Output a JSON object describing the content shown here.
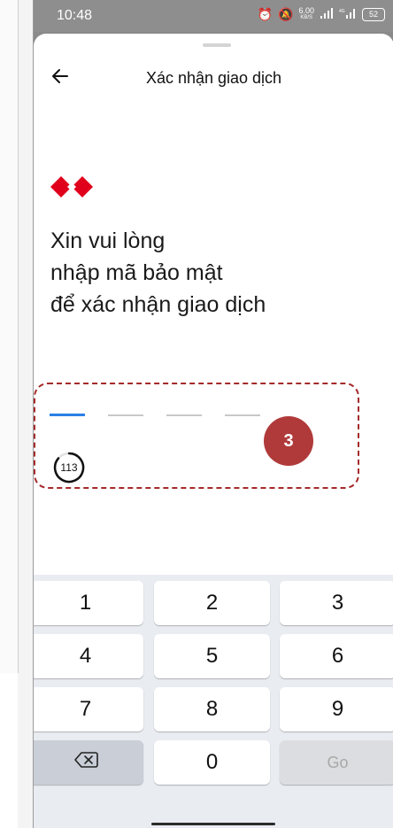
{
  "status_bar": {
    "time": "10:48",
    "icons": [
      "alarm-icon",
      "mute-icon",
      "network-speed",
      "signal-icon",
      "signal-4g-icon",
      "battery-icon"
    ],
    "speed_value": "6.00",
    "speed_unit": "KB/S",
    "battery_level": "52"
  },
  "header": {
    "title": "Xác nhận giao dịch",
    "back_icon": "arrow-left-icon"
  },
  "logo": {
    "icon": "bank-logo-diamonds",
    "color": "#e0001b"
  },
  "prompt": {
    "line1": "Xin vui lòng",
    "line2": "nhập mã bảo mật",
    "line3": "để xác nhận giao dịch"
  },
  "pin": {
    "slot_count": 4,
    "active_slot": 1,
    "countdown": "113"
  },
  "badge": {
    "label": "3",
    "color": "#b03a3a"
  },
  "keyboard": {
    "row1": [
      "1",
      "2",
      "3"
    ],
    "row2": [
      "4",
      "5",
      "6"
    ],
    "row3": [
      "7",
      "8",
      "9"
    ],
    "backspace_icon": "backspace-icon",
    "zero": "0",
    "go": "Go"
  },
  "colors": {
    "accent": "#2b7fe6",
    "highlight_border": "#a52a2a"
  }
}
